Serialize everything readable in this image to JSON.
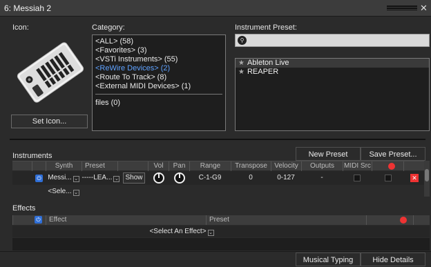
{
  "window": {
    "title": "6: Messiah 2"
  },
  "icon_section": {
    "label": "Icon:",
    "set_icon_button": "Set Icon..."
  },
  "category": {
    "label": "Category:",
    "items": [
      {
        "text": "<ALL> (58)",
        "selected": false
      },
      {
        "text": "<Favorites> (3)",
        "selected": false
      },
      {
        "text": "<VSTi Instruments> (55)",
        "selected": false
      },
      {
        "text": "<ReWire Devices> (2)",
        "selected": true
      },
      {
        "text": "<Route To Track> (8)",
        "selected": false
      },
      {
        "text": "<External MIDI Devices> (1)",
        "selected": false
      }
    ],
    "files": "files (0)"
  },
  "instrument_preset": {
    "label": "Instrument Preset:",
    "search_value": "",
    "items": [
      {
        "text": "Ableton Live",
        "selected": true
      },
      {
        "text": "REAPER",
        "selected": false
      }
    ]
  },
  "instruments": {
    "label": "Instruments",
    "new_preset": "New Preset",
    "save_preset": "Save Preset...",
    "columns": [
      "Synth",
      "Preset",
      "Vol",
      "Pan",
      "Range",
      "Transpose",
      "Velocity",
      "Outputs",
      "MIDI Src"
    ],
    "row": {
      "synth": "Messi...",
      "preset": "-----LEA...",
      "show": "Show",
      "range": "C-1-G9",
      "transpose": "0",
      "velocity": "0-127",
      "outputs": "-"
    },
    "select_row": "<Sele..."
  },
  "effects": {
    "label": "Effects",
    "columns": [
      "Effect",
      "Preset"
    ],
    "select_effect": "<Select An Effect>"
  },
  "bottom": {
    "musical_typing": "Musical Typing",
    "hide_details": "Hide Details"
  },
  "colors": {
    "accent_blue": "#5fa2ff",
    "power_blue": "#2f6fd8",
    "record_red": "#ee3333"
  }
}
